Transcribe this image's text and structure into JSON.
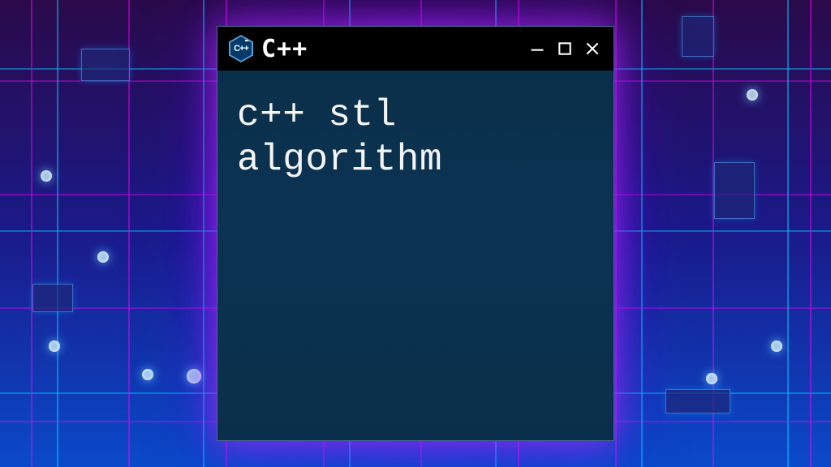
{
  "window": {
    "title": "C++",
    "icon_label": "C++",
    "body_text": "c++ stl\nalgorithm"
  },
  "controls": {
    "minimize": "minimize",
    "maximize": "maximize",
    "close": "close"
  }
}
